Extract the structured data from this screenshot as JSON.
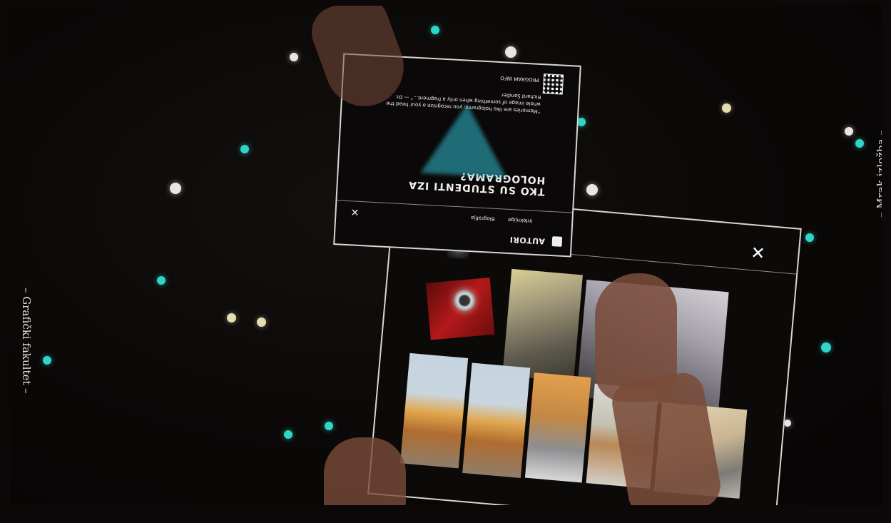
{
  "screen": {
    "left_label": "– Grafički fakultet –",
    "right_label": "– Mrak izložba –"
  },
  "small_window": {
    "section_title": "AUTORI",
    "tab_1": "Infoknjige",
    "tab_2": "Biografija",
    "headline": "TKO SU STUDENTI IZA HOLOGRAMA?",
    "quote": "“Memories are like holograms: you recognize a your head the whole image of something when only a fragment...” — Dr. Richard Sandler",
    "qr_caption": "PROGRAM INFO",
    "close_glyph": "✕"
  },
  "big_window": {
    "close_glyph": "✕"
  },
  "icons": [
    "close-icon",
    "qr-code-icon",
    "author-icon"
  ],
  "colors": {
    "teal_dot": "#2fd6c8",
    "white_dot": "#e8e6e4",
    "yellow_dot": "#e4ddb0",
    "background": "#0b0807"
  }
}
